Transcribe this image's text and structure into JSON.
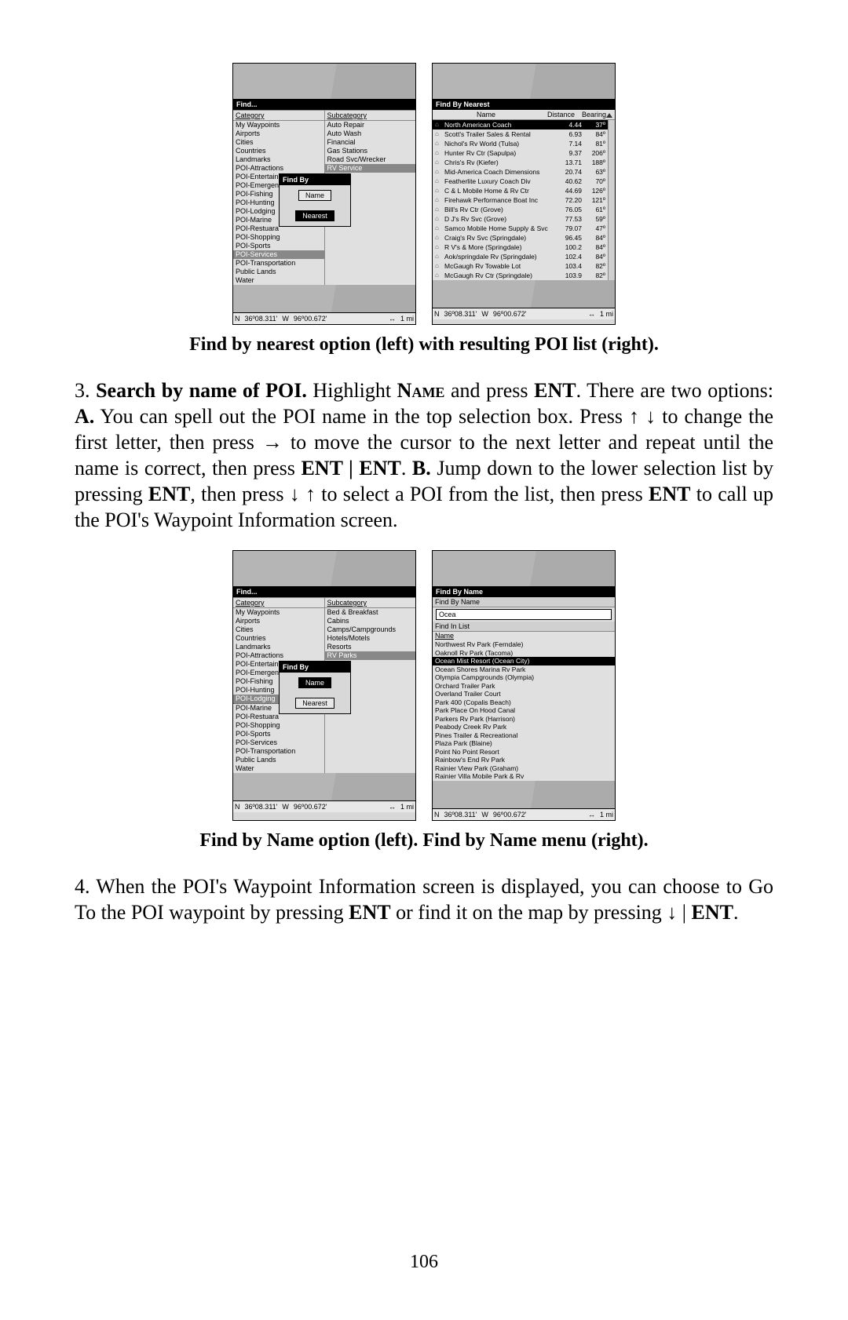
{
  "figA": {
    "left": {
      "title": "Find...",
      "catHeader": "Category",
      "subHeader": "Subcategory",
      "categories": [
        "My Waypoints",
        "Airports",
        "Cities",
        "Countries",
        "Landmarks",
        "POI-Attractions",
        "POI-Entertainm",
        "POI-Emergenc",
        "POI-Fishing",
        "POI-Hunting",
        "POI-Lodging",
        "POI-Marine",
        "POI-Restuara",
        "POI-Shopping",
        "POI-Sports",
        "POI-Services",
        "POI-Transportation",
        "Public Lands",
        "Water"
      ],
      "catHighlightIdx": 15,
      "subcategories": [
        "Auto Repair",
        "Auto Wash",
        "Financial",
        "Gas Stations",
        "Road Svc/Wrecker",
        "RV Service"
      ],
      "subHighlightIdx": 5,
      "popupTitle": "Find By",
      "popupBtnName": "Name",
      "popupBtnNearest": "Nearest",
      "popupSelected": "Nearest"
    },
    "right": {
      "title": "Find By Nearest",
      "hdrName": "Name",
      "hdrDist": "Distance",
      "hdrBear": "Bearing",
      "rows": [
        {
          "n": "North American Coach",
          "d": "4.44",
          "b": "37º",
          "sel": true
        },
        {
          "n": "Scott's Trailer Sales & Rental",
          "d": "6.93",
          "b": "84º"
        },
        {
          "n": "Nichol's Rv World (Tulsa)",
          "d": "7.14",
          "b": "81º"
        },
        {
          "n": "Hunter Rv Ctr (Sapulpa)",
          "d": "9.37",
          "b": "206º"
        },
        {
          "n": "Chris's Rv (Kiefer)",
          "d": "13.71",
          "b": "188º"
        },
        {
          "n": "Mid-America Coach Dimensions",
          "d": "20.74",
          "b": "63º"
        },
        {
          "n": "Featherlite Luxury Coach Div",
          "d": "40.62",
          "b": "70º"
        },
        {
          "n": "C & L Mobile Home & Rv Ctr",
          "d": "44.69",
          "b": "126º"
        },
        {
          "n": "Firehawk Performance Boat Inc",
          "d": "72.20",
          "b": "121º"
        },
        {
          "n": "Bill's Rv Ctr (Grove)",
          "d": "76.05",
          "b": "61º"
        },
        {
          "n": "D J's Rv Svc (Grove)",
          "d": "77.53",
          "b": "59º"
        },
        {
          "n": "Samco Mobile Home Supply & Svc",
          "d": "79.07",
          "b": "47º"
        },
        {
          "n": "Craig's Rv Svc (Springdale)",
          "d": "96.45",
          "b": "84º"
        },
        {
          "n": "R V's & More (Springdale)",
          "d": "100.2",
          "b": "84º"
        },
        {
          "n": "Aok/springdale Rv (Springdale)",
          "d": "102.4",
          "b": "84º"
        },
        {
          "n": "McGaugh Rv Towable Lot",
          "d": "103.4",
          "b": "82º"
        },
        {
          "n": "McGaugh Rv Ctr (Springdale)",
          "d": "103.9",
          "b": "82º"
        }
      ]
    },
    "status": {
      "nLabel": "N",
      "lat": "36º08.311'",
      "wLabel": "W",
      "lon": "96º00.672'",
      "scale": "1 mi"
    },
    "caption": "Find by nearest option (left) with resulting POI list (right)."
  },
  "para3": {
    "num": "3. ",
    "lead": "Search by name of POI.",
    "t1": " Highlight ",
    "name": "Name",
    "t2": " and press ",
    "ent": "ENT",
    "t3": ". There are two options: ",
    "A": "A.",
    "t4": " You can spell out the POI name in the top selection box. Press ↑ ↓ to change the first letter, then press → to move the cursor to the next letter and repeat until the name is correct, then press ",
    "entent": "ENT | ENT",
    "t5": ". ",
    "B": "B.",
    "t6": " Jump down to the lower selection list by pressing ",
    "ent2": "ENT",
    "t7": ", then press ↓ ↑ to select a POI from the list, then press ",
    "ent3": "ENT",
    "t8": " to call up the POI's Waypoint Information screen."
  },
  "figB": {
    "left": {
      "title": "Find...",
      "catHeader": "Category",
      "subHeader": "Subcategory",
      "categories": [
        "My Waypoints",
        "Airports",
        "Cities",
        "Countries",
        "Landmarks",
        "POI-Attractions",
        "POI-Entertainm",
        "POI-Emergenc",
        "POI-Fishing",
        "POI-Hunting",
        "POI-Lodging",
        "POI-Marine",
        "POI-Restuara",
        "POI-Shopping",
        "POI-Sports",
        "POI-Services",
        "POI-Transportation",
        "Public Lands",
        "Water"
      ],
      "catHighlightIdx": 10,
      "subcategories": [
        "Bed & Breakfast",
        "Cabins",
        "Camps/Campgrounds",
        "Hotels/Motels",
        "Resorts",
        "RV Parks"
      ],
      "subHighlightIdx": 5,
      "popupTitle": "Find By",
      "popupBtnName": "Name",
      "popupBtnNearest": "Nearest",
      "popupSelected": "Name"
    },
    "right": {
      "title": "Find By Name",
      "section1": "Find By Name",
      "inputValue": "Ocea",
      "section2": "Find In List",
      "listHeader": "Name",
      "items": [
        "Northwest Rv Park (Ferndale)",
        "Oaknoll Rv Park (Tacoma)",
        "Ocean Mist Resort (Ocean City)",
        "Ocean Shores Marina Rv Park",
        "Olympia Campgrounds (Olympia)",
        "Orchard Trailer Park",
        "Overland Trailer Court",
        "Park 400 (Copalis Beach)",
        "Park Place On Hood Canal",
        "Parkers Rv Park (Harrison)",
        "Peabody Creek Rv Park",
        "Pines Trailer & Recreational",
        "Plaza Park (Blaine)",
        "Point No Point Resort",
        "Rainbow's End Rv Park",
        "Rainier View Park (Graham)",
        "Rainier Villa Mobile Park & Rv"
      ],
      "selIdx": 2
    },
    "caption": "Find by Name option (left). Find by Name menu (right)."
  },
  "para4": {
    "num": "4. ",
    "t1": "When the POI's Waypoint Information screen is displayed, you can choose to Go To the POI waypoint by pressing ",
    "ent": "ENT",
    "t2": " or find it on the map by pressing ↓ | ",
    "ent2": "ENT",
    "t3": "."
  },
  "pageNum": "106"
}
